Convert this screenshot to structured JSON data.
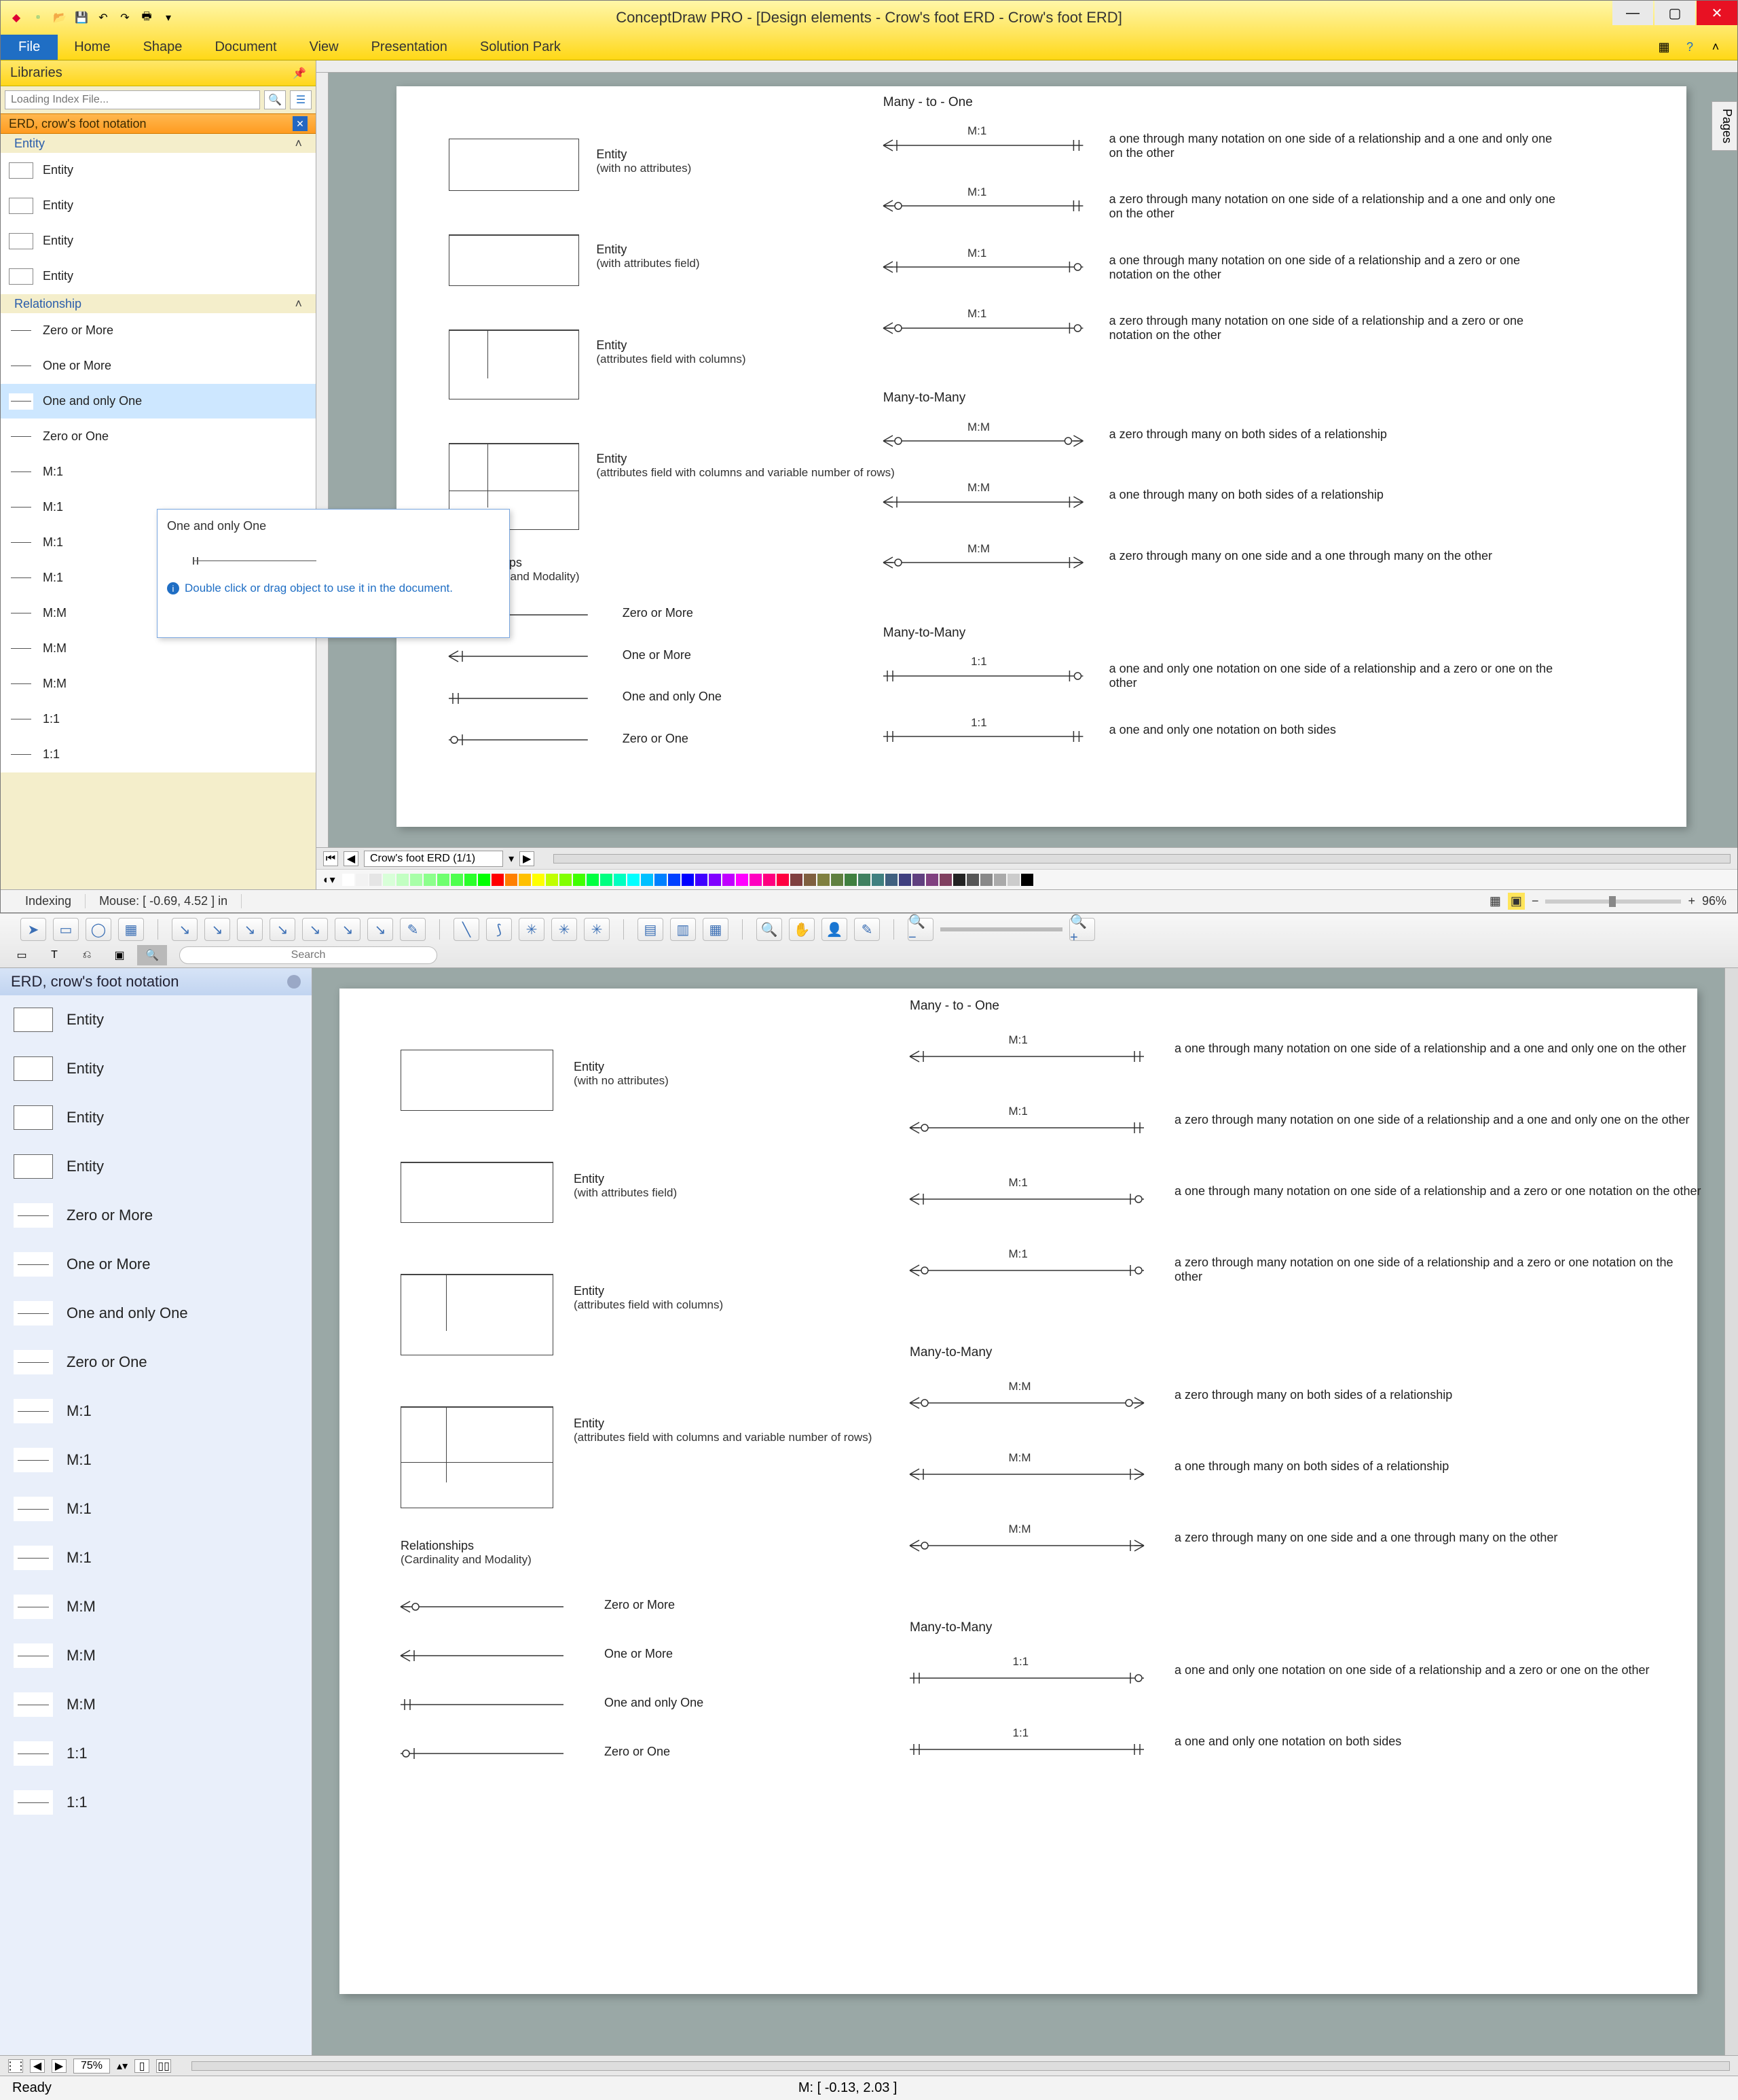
{
  "win": {
    "title": "ConceptDraw PRO - [Design elements - Crow's foot ERD - Crow's foot ERD]",
    "file_tab": "File",
    "tabs": [
      "Home",
      "Shape",
      "Document",
      "View",
      "Presentation",
      "Solution Park"
    ],
    "libraries_label": "Libraries",
    "search_placeholder": "Loading Index File...",
    "stencil_title": "ERD, crow's foot notation",
    "cat_entity": "Entity",
    "cat_rel": "Relationship",
    "entity_items": [
      "Entity",
      "Entity",
      "Entity",
      "Entity"
    ],
    "rel_items": [
      "Zero or More",
      "One or More",
      "One and only One",
      "Zero or One",
      "M:1",
      "M:1",
      "M:1",
      "M:1",
      "M:M",
      "M:M",
      "M:M",
      "1:1",
      "1:1"
    ],
    "sel_index": 2,
    "tooltip_title": "One and only One",
    "tooltip_hint": "Double click or drag object to use it in the document.",
    "doc_tab": "Crow's foot ERD (1/1)",
    "pages_label": "Pages",
    "status_indexing": "Indexing",
    "status_mouse": "Mouse: [ -0.69, 4.52 ] in",
    "zoom": "96%"
  },
  "mac": {
    "search_placeholder": "Search",
    "stencil_title": "ERD, crow's foot notation",
    "items": [
      "Entity",
      "Entity",
      "Entity",
      "Entity",
      "Zero or More",
      "One or More",
      "One and only One",
      "Zero or One",
      "M:1",
      "M:1",
      "M:1",
      "M:1",
      "M:M",
      "M:M",
      "M:M",
      "1:1",
      "1:1"
    ],
    "zoom": "75%",
    "status_ready": "Ready",
    "status_mouse": "M: [ -0.13, 2.03 ]"
  },
  "diagram": {
    "entities": [
      {
        "label": "Entity",
        "sub": "(with no attributes)"
      },
      {
        "label": "Entity",
        "sub": "(with attributes field)"
      },
      {
        "label": "Entity",
        "sub": "(attributes field with columns)"
      },
      {
        "label": "Entity",
        "sub": "(attributes field with columns and variable number of rows)"
      }
    ],
    "rel_heading": "Relationships",
    "rel_sub": "(Cardinality and Modality)",
    "rel_left": [
      "Zero or More",
      "One or More",
      "One and only One",
      "Zero or One"
    ],
    "sec_m1": "Many - to - One",
    "sec_mm": "Many-to-Many",
    "sec_mm2": "Many-to-Many",
    "m1": [
      {
        "tag": "M:1",
        "desc": "a one through many notation on one side of a relationship and a one and only one on the other"
      },
      {
        "tag": "M:1",
        "desc": "a zero through many notation on one side of a relationship and a one and only one on the other"
      },
      {
        "tag": "M:1",
        "desc": "a one through many notation on one side of a relationship and a zero or one notation on the other"
      },
      {
        "tag": "M:1",
        "desc": "a zero through many notation on one side of a relationship and a zero or one notation on the other"
      }
    ],
    "mm": [
      {
        "tag": "M:M",
        "desc": "a zero through many on both sides of a relationship"
      },
      {
        "tag": "M:M",
        "desc": "a one through many on both sides of a relationship"
      },
      {
        "tag": "M:M",
        "desc": "a zero through many on one side and a one through many on the other"
      }
    ],
    "oo": [
      {
        "tag": "1:1",
        "desc": "a one and only one notation on one side of a relationship and a zero or one on the other"
      },
      {
        "tag": "1:1",
        "desc": "a one and only one notation on both sides"
      }
    ]
  },
  "palette": [
    "#ffffff",
    "#f2f2f2",
    "#e5e5e5",
    "#d8ffd8",
    "#c2ffc2",
    "#a8ffa8",
    "#8cff8c",
    "#6eff6e",
    "#4eff4e",
    "#2aff2a",
    "#00ff00",
    "#ff0000",
    "#ff8000",
    "#ffc000",
    "#ffff00",
    "#c0ff00",
    "#80ff00",
    "#40ff00",
    "#00ff40",
    "#00ff80",
    "#00ffc0",
    "#00ffff",
    "#00c0ff",
    "#0080ff",
    "#0040ff",
    "#0000ff",
    "#4000ff",
    "#8000ff",
    "#c000ff",
    "#ff00ff",
    "#ff00c0",
    "#ff0080",
    "#ff0040",
    "#804040",
    "#806040",
    "#808040",
    "#608040",
    "#408040",
    "#408060",
    "#408080",
    "#406080",
    "#404080",
    "#604080",
    "#804080",
    "#804060",
    "#222222",
    "#555555",
    "#888888",
    "#aaaaaa",
    "#cccccc",
    "#000000"
  ]
}
